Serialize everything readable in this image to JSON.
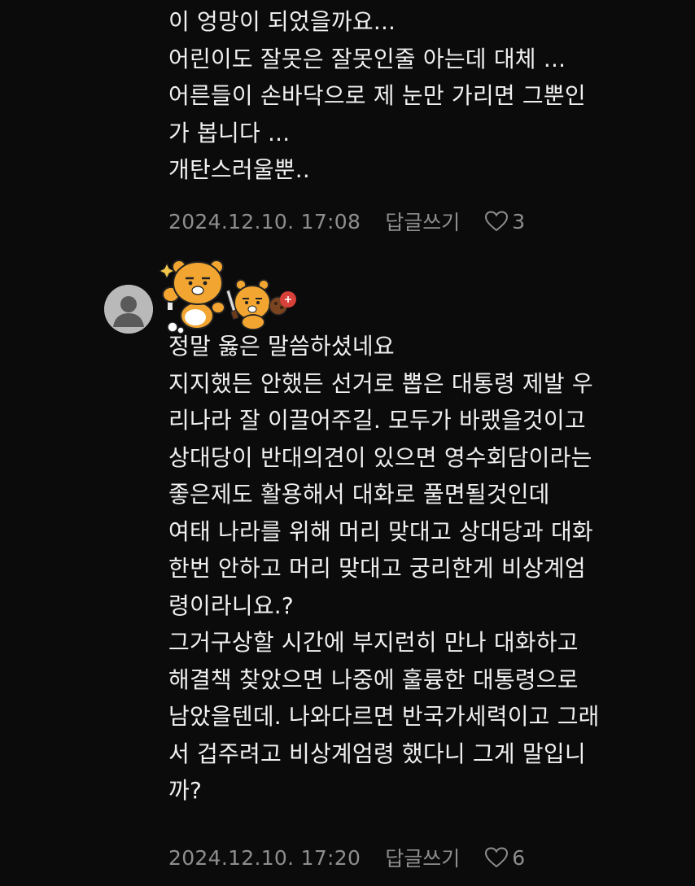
{
  "comments": [
    {
      "lines": [
        "이 엉망이 되었을까요...",
        "어린이도 잘못은 잘못인줄 아는데 대체 ...",
        "어른들이 손바닥으로 제 눈만 가리면 그뿐인",
        "가 봅니다 ...",
        "개탄스러울뿐.."
      ],
      "date": "2024.12.10. 17:08",
      "reply_label": "답글쓰기",
      "likes": "3"
    },
    {
      "lines": [
        "정말 옳은 말씀하셨네요",
        "지지했든 안했든 선거로 뽑은 대통령 제발 우",
        "리나라 잘 이끌어주길. 모두가 바랬을것이고",
        "상대당이 반대의견이 있으면 영수회담이라는",
        "좋은제도 활용해서 대화로 풀면될것인데",
        "여태 나라를 위해 머리 맞대고 상대당과 대화",
        "한번 안하고 머리 맞대고 궁리한게 비상계엄",
        "령이라니요.?",
        "그거구상할 시간에 부지런히 만나 대화하고",
        "해결책 찾았으면 나중에 훌륭한 대통령으로",
        "남았을텐데. 나와다르면 반국가세력이고 그래",
        "서 겁주려고 비상계엄령 했다니 그게 말입니",
        "까?"
      ],
      "date": "2024.12.10. 17:20",
      "reply_label": "답글쓰기",
      "likes": "6"
    }
  ],
  "icons": {
    "avatar": "default-user-avatar-icon",
    "sticker": "ryan-bear-sticker",
    "like": "heart-outline-icon"
  },
  "colors": {
    "background": "#0b0b0b",
    "text": "#f0f0f0",
    "meta": "#8e8e8e",
    "avatar": "#b9b9b9",
    "sticker_orange": "#f2a530",
    "badge_red": "#d8403a"
  }
}
